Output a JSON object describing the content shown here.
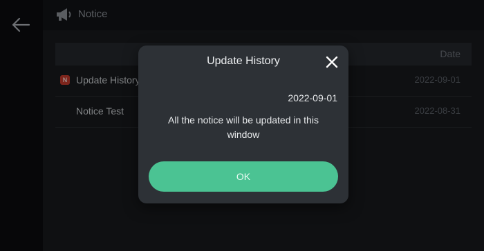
{
  "header": {
    "title": "Notice",
    "icon": "megaphone-icon"
  },
  "nav": {
    "back_icon": "arrow-left-icon"
  },
  "table": {
    "column_date": "Date",
    "rows": [
      {
        "name": "Update History",
        "date": "2022-09-01",
        "badge": "N"
      },
      {
        "name": "Notice Test",
        "date": "2022-08-31",
        "badge": ""
      }
    ]
  },
  "dialog": {
    "title": "Update History",
    "date": "2022-09-01",
    "message": "All the notice will be updated in this window",
    "ok_label": "OK",
    "close_icon": "close-icon"
  },
  "colors": {
    "accent": "#4bc393",
    "badge": "#c0392b",
    "dialog_bg": "#2d3136",
    "page_bg": "#17191c"
  }
}
